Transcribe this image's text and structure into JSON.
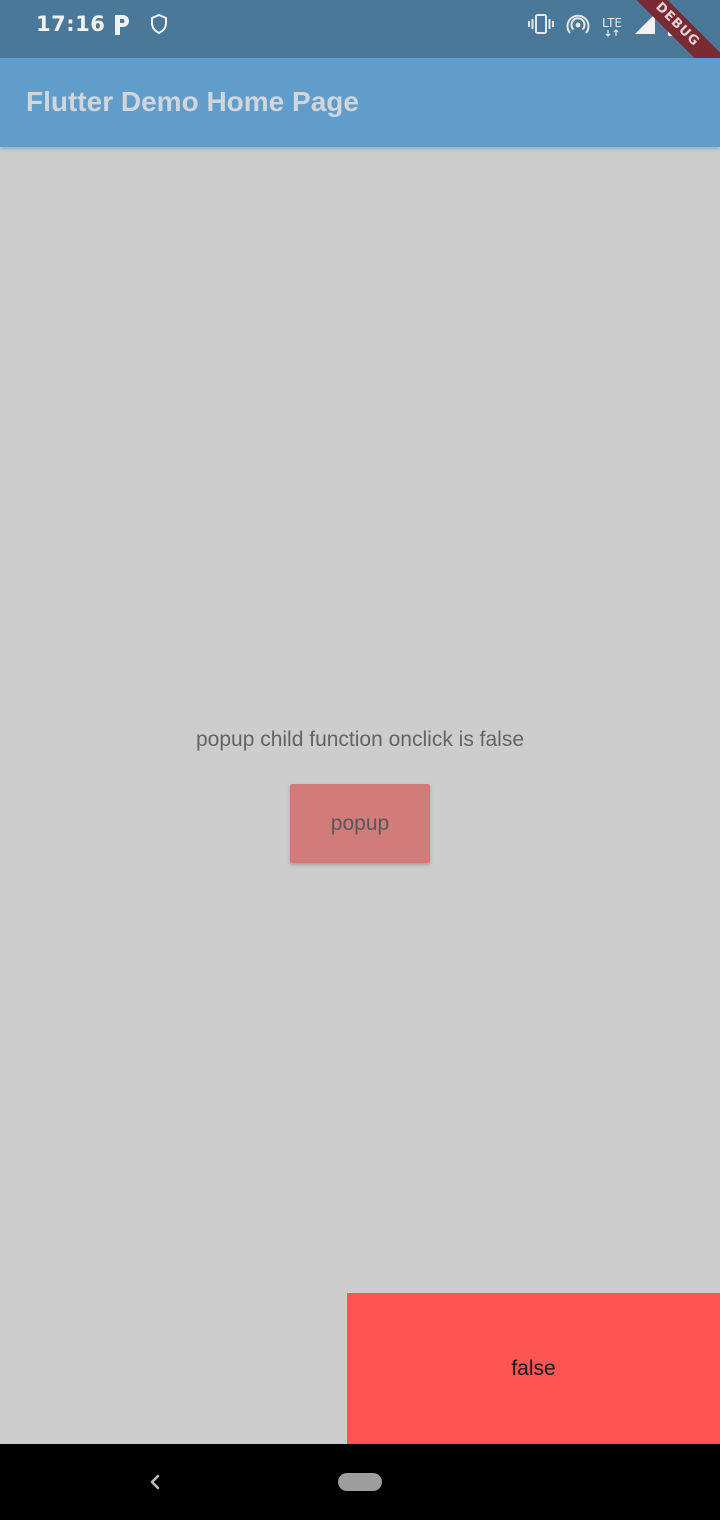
{
  "status_bar": {
    "time": "17:16",
    "left_icons": [
      "parking-icon",
      "shield-icon"
    ],
    "right_icons": [
      "vibrate-icon",
      "hotspot-icon",
      "lte-icon",
      "signal-icon",
      "battery-charging-icon"
    ],
    "network_label": "LTE",
    "background": "#4a7898"
  },
  "debug_banner": {
    "label": "DEBUG",
    "color": "#7a2a33"
  },
  "app_bar": {
    "title": "Flutter Demo Home Page",
    "background": "#619dca"
  },
  "main": {
    "message": "popup child function onclick is false",
    "popup_button_label": "popup",
    "popup_button_color": "#d17b7b",
    "background": "#cdcdcd"
  },
  "result_box": {
    "label": "false",
    "color": "#ff5454"
  },
  "nav_bar": {
    "back_icon": "back-chevron-icon",
    "home_icon": "home-pill-icon"
  }
}
